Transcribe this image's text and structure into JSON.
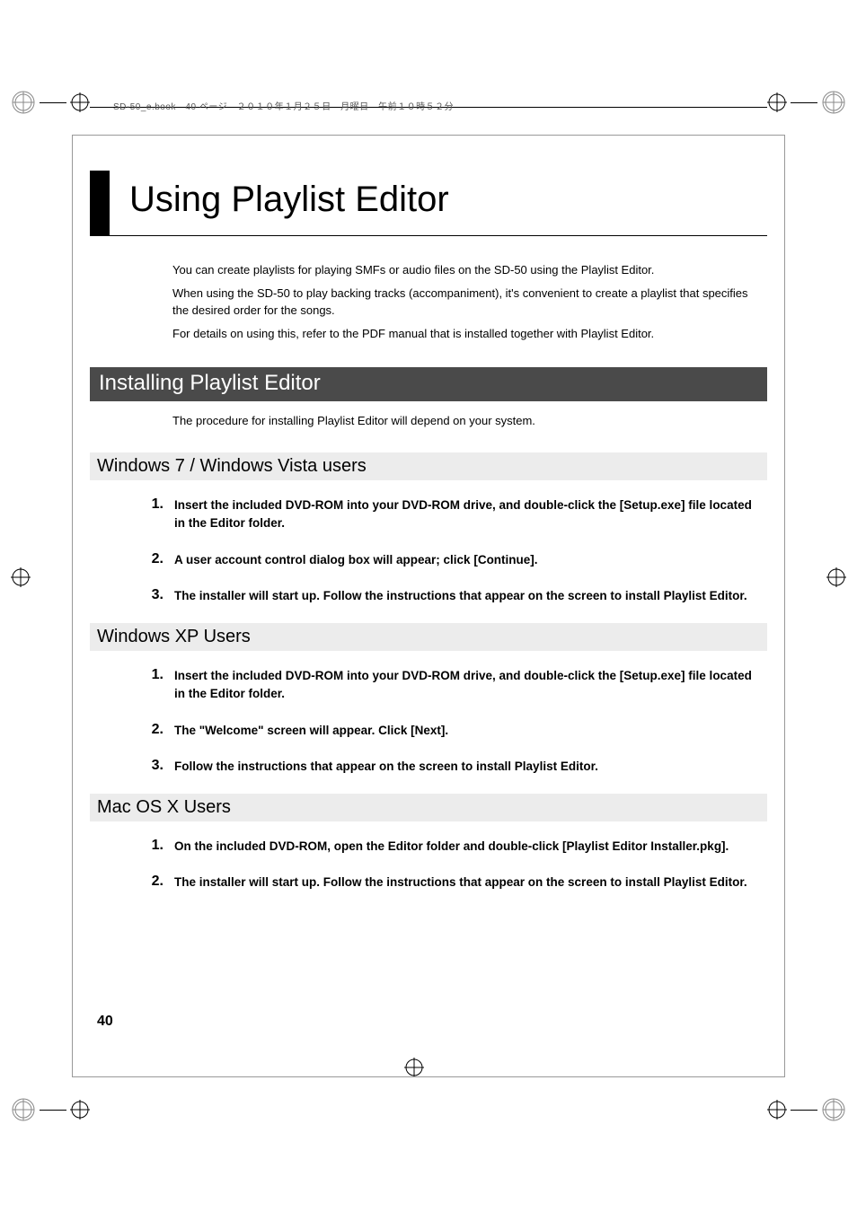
{
  "header_meta": "SD-50_e.book　40 ページ　２０１０年１月２５日　月曜日　午前１０時５２分",
  "chapter_title": "Using Playlist Editor",
  "intro": [
    "You can create playlists for playing SMFs or audio files on the SD-50 using the Playlist Editor.",
    "When using the SD-50 to play backing tracks (accompaniment), it's convenient to create a playlist that specifies the desired order for the songs.",
    "For details on using this, refer to the PDF manual that is installed together with Playlist Editor."
  ],
  "section_title": "Installing Playlist Editor",
  "section_intro": "The procedure for installing Playlist Editor will depend on your system.",
  "subsections": [
    {
      "title": "Windows 7 / Windows Vista users",
      "steps": [
        "Insert the included DVD-ROM into your DVD-ROM drive, and double-click the [Setup.exe] file located in the Editor folder.",
        "A user account control dialog box will appear; click [Continue].",
        "The installer will start up. Follow the instructions that appear on the screen to install Playlist Editor."
      ]
    },
    {
      "title": "Windows XP Users",
      "steps": [
        "Insert the included DVD-ROM into your DVD-ROM drive, and double-click the [Setup.exe] file located in the Editor folder.",
        "The \"Welcome\" screen will appear. Click [Next].",
        " Follow the instructions that appear on the screen to install Playlist Editor."
      ]
    },
    {
      "title": "Mac OS X Users",
      "steps": [
        "On the included DVD-ROM, open the Editor folder and double-click [Playlist Editor Installer.pkg].",
        "The installer will start up. Follow the instructions that appear on the screen to install Playlist Editor."
      ]
    }
  ],
  "page_number": "40"
}
